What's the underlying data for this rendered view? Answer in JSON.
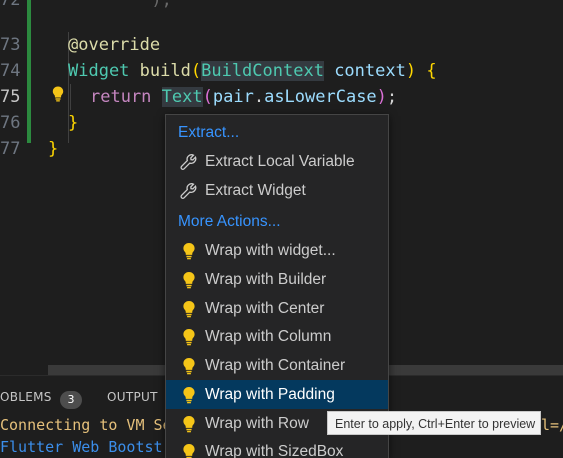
{
  "editor": {
    "lines": [
      {
        "num": "72",
        "code": ""
      },
      {
        "num": "73",
        "code": "@override"
      },
      {
        "num": "74",
        "code": "Widget build(BuildContext context) {"
      },
      {
        "num": "75",
        "code": "return Text(pair.asLowerCase);"
      },
      {
        "num": "76",
        "code": "}"
      },
      {
        "num": "77",
        "code": "}"
      }
    ],
    "active_line": "75"
  },
  "code_tokens": {
    "l73": {
      "ann": "@override"
    },
    "l74": {
      "t1": "Widget",
      "t2": "build",
      "t3": "(",
      "t4": "BuildContext",
      "t5": "context",
      "t6": ")",
      "t7": "{"
    },
    "l75": {
      "t1": "return",
      "t2": "Text",
      "t3": "(",
      "t4": "pair",
      "t5": ".",
      "t6": "asLowerCase",
      "t7": ")",
      "t8": ";"
    },
    "l76": {
      "t1": "}"
    },
    "l77": {
      "t1": "}"
    }
  },
  "menu": {
    "items": [
      {
        "label": "Extract...",
        "type": "header"
      },
      {
        "label": "Extract Local Variable",
        "icon": "wrench-icon"
      },
      {
        "label": "Extract Widget",
        "icon": "wrench-icon"
      },
      {
        "label": "More Actions...",
        "type": "header"
      },
      {
        "label": "Wrap with widget...",
        "icon": "lightbulb-icon"
      },
      {
        "label": "Wrap with Builder",
        "icon": "lightbulb-icon"
      },
      {
        "label": "Wrap with Center",
        "icon": "lightbulb-icon"
      },
      {
        "label": "Wrap with Column",
        "icon": "lightbulb-icon"
      },
      {
        "label": "Wrap with Container",
        "icon": "lightbulb-icon"
      },
      {
        "label": "Wrap with Padding",
        "icon": "lightbulb-icon",
        "selected": true
      },
      {
        "label": "Wrap with Row",
        "icon": "lightbulb-icon"
      },
      {
        "label": "Wrap with SizedBox",
        "icon": "lightbulb-icon"
      }
    ]
  },
  "tooltip": {
    "text": "Enter to apply, Ctrl+Enter to preview"
  },
  "panel": {
    "tabs": {
      "problems": "OBLEMS",
      "problems_count": "3",
      "output": "OUTPUT"
    },
    "terminal": {
      "line1": "Connecting to VM Se",
      "line1_tail": "l=/",
      "line2": "Flutter Web Bootstr"
    }
  },
  "colors": {
    "background": "#1e1e1e",
    "menu_bg": "#252526",
    "menu_selected": "#04395e",
    "header_blue": "#3794ff",
    "bulb_yellow": "#f5c518"
  }
}
